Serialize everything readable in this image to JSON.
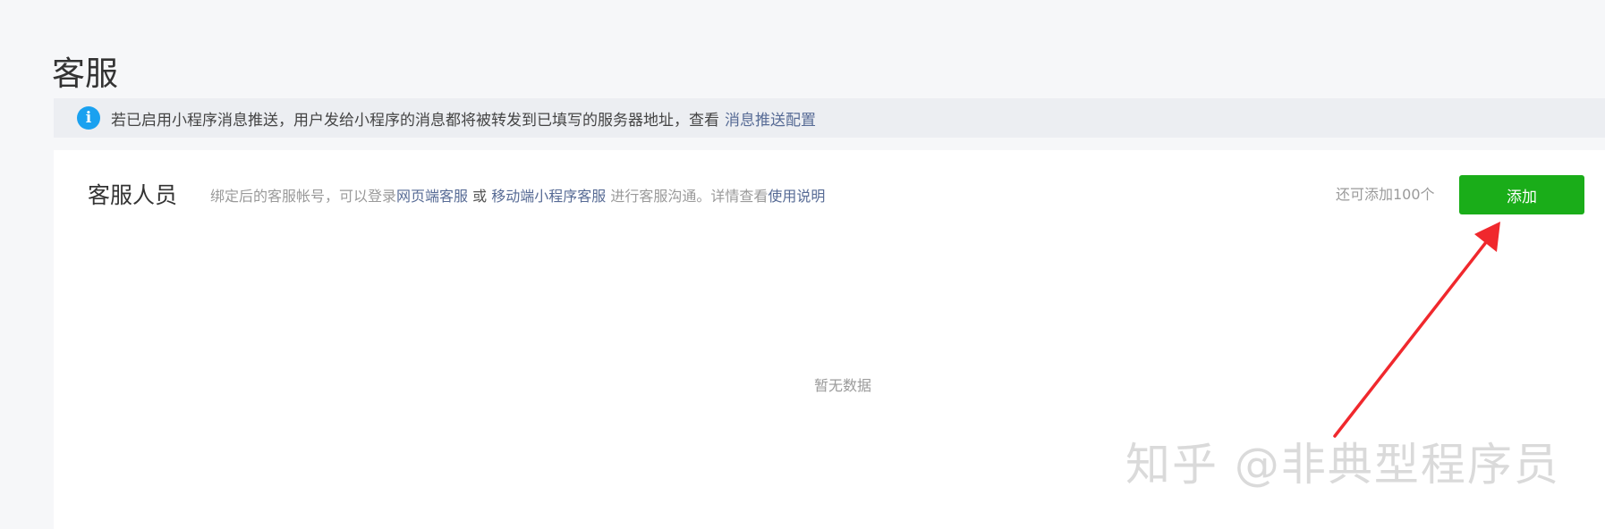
{
  "page": {
    "title": "客服"
  },
  "notice": {
    "icon": "info-icon",
    "text": "若已启用小程序消息推送，用户发给小程序的消息都将被转发到已填写的服务器地址，查看",
    "link_label": "消息推送配置"
  },
  "section": {
    "title": "客服人员",
    "desc_before": "绑定后的客服帐号，可以登录",
    "link_web": "网页端客服",
    "desc_or": " 或 ",
    "link_mobile": "移动端小程序客服",
    "desc_after": " 进行客服沟通。详情查看",
    "link_usage": "使用说明",
    "remaining": "还可添加100个",
    "add_label": "添加",
    "empty": "暂无数据"
  },
  "watermark": {
    "text": "知乎 @非典型程序员"
  },
  "colors": {
    "primary_green": "#1aad19",
    "link_blue": "#576b95",
    "info_blue": "#1aa1f0",
    "arrow_red": "#f0282d"
  }
}
